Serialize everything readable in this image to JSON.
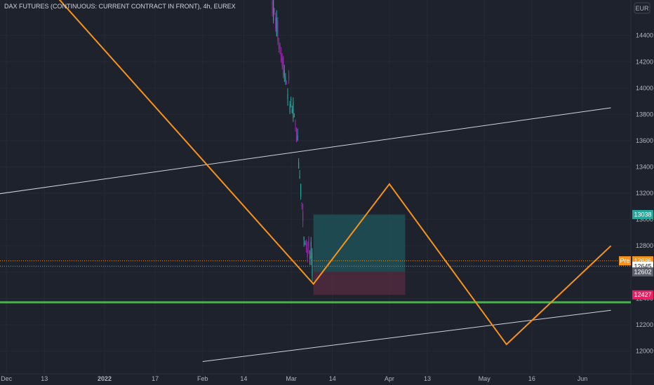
{
  "chart_data": {
    "type": "line",
    "title": "DAX FUTURES (CONTINUOUS: CURRENT CONTRACT IN FRONT), 4h, EUREX",
    "currency": "EUR",
    "x_ticks": [
      "Dec",
      "13",
      "2022",
      "17",
      "Feb",
      "14",
      "Mar",
      "14",
      "Apr",
      "13",
      "May",
      "16",
      "Jun"
    ],
    "y_ticks": [
      12000,
      12200,
      12400,
      12600,
      12800,
      13000,
      13200,
      13400,
      13600,
      13800,
      14000,
      14200,
      14400
    ],
    "ylim": [
      11900,
      14640
    ],
    "price_labels": [
      {
        "text": "13038",
        "value": 13038,
        "bg": "#26a69a",
        "fg": "#ffffff"
      },
      {
        "text": "12686",
        "value": 12686,
        "bg": "#f7931a",
        "fg": "#ffffff",
        "prefix": "Pre"
      },
      {
        "text": "12645",
        "value": 12645,
        "bg": "#ffffff",
        "fg": "#131722"
      },
      {
        "text": "12602",
        "value": 12602,
        "bg": "#5d606b",
        "fg": "#ffffff"
      },
      {
        "text": "12427",
        "value": 12427,
        "bg": "#e91e63",
        "fg": "#ffffff"
      }
    ],
    "orange_path": [
      {
        "x": "2021-12-13",
        "y": 14800
      },
      {
        "x": "2022-03-08",
        "y": 12510
      },
      {
        "x": "2022-04-01",
        "y": 13270
      },
      {
        "x": "2022-05-08",
        "y": 12050
      },
      {
        "x": "2022-06-10",
        "y": 12800
      }
    ],
    "green_line": {
      "y": 12370
    },
    "upper_white_line": [
      {
        "x": "2021-11-27",
        "y": 13190
      },
      {
        "x": "2022-06-10",
        "y": 13850
      }
    ],
    "lower_white_line": [
      {
        "x": "2022-02-01",
        "y": 11920
      },
      {
        "x": "2022-06-10",
        "y": 12310
      }
    ],
    "position_box": {
      "start": "2022-03-08",
      "end": "2022-04-06",
      "entry": 12602,
      "target": 13038,
      "stop": 12427
    },
    "reference_lines": [
      12686,
      12645
    ],
    "colors": {
      "background": "#1e222d",
      "orange": "#f7931a",
      "green": "#4caf50",
      "white_line": "#d1d4dc",
      "profit_fill": "#1f4e54",
      "loss_fill": "#4a2a3c",
      "candle_up": "#26a69a",
      "candle_down": "#9c27b0"
    }
  }
}
